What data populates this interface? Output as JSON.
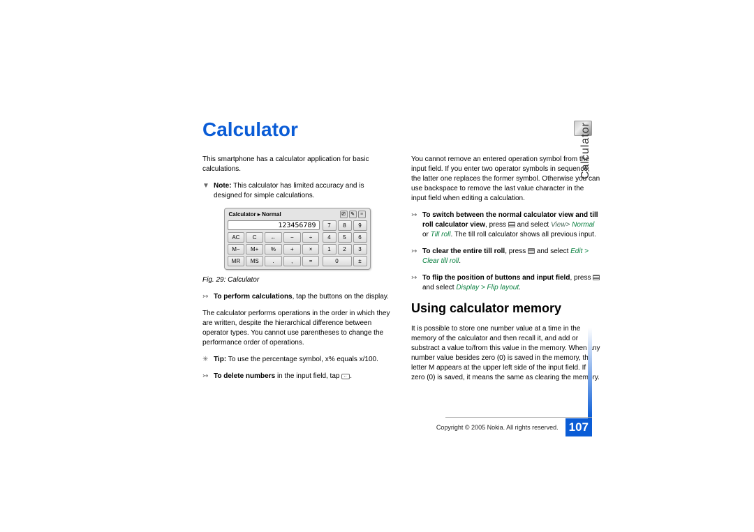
{
  "title": "Calculator",
  "side_tab": "Calculator",
  "left": {
    "intro": "This smartphone has a calculator application for basic calculations.",
    "note_label": "Note:",
    "note_text": "This calculator has limited accuracy and is designed for simple calculations.",
    "fig_caption": "Fig. 29: Calculator",
    "perform_bold": "To perform calculations",
    "perform_rest": ", tap the buttons on the display.",
    "order_para": "The calculator performs operations in the order in which they are written, despite the hierarchical difference between operator types. You cannot use parentheses to change the performance order of operations.",
    "tip_label": "Tip:",
    "tip_text": " To use the percentage symbol, x% equals x/100.",
    "delete_bold": "To delete numbers",
    "delete_rest": " in the input field, tap "
  },
  "right": {
    "intro": "You cannot remove an entered operation symbol from the input field. If you enter two operator symbols in sequence, the latter one replaces the former symbol. Otherwise you can use backspace to remove the last value character in the input field when editing a calculation.",
    "switch_bold": "To switch between the normal calculator view and till roll calculator view",
    "switch_mid": ", press ",
    "switch_select": " and select ",
    "switch_view": "View>",
    "switch_normal": "Normal",
    "switch_or": " or ",
    "switch_tillroll": "Till roll",
    "switch_tail": ". The till roll calculator shows all previous input.",
    "clear_bold": "To clear the entire till roll",
    "clear_mid": ", press ",
    "clear_select": " and select",
    "clear_menu": "Edit > Clear till roll",
    "clear_period": ".",
    "flip_bold": "To flip the position of buttons and input field",
    "flip_mid": ", press",
    "flip_select": " and select ",
    "flip_menu": "Display > Flip layout",
    "flip_period": ".",
    "subhead": "Using calculator memory",
    "memory_para": "It is possible to store one number value at a time in the memory of the calculator and then recall it, and add or substract a value to/from this value in the memory. When any number value besides zero (0) is saved in the memory, the letter M appears at the upper left side of the input field. If zero (0) is saved, it means the same as clearing the memory."
  },
  "calculator": {
    "title_app": "Calculator",
    "title_caret": "▸",
    "title_mode": "Normal",
    "display": "123456789",
    "left_buttons": [
      "AC",
      "C",
      "←",
      "−",
      "÷",
      "M−",
      "M+",
      "%",
      "+",
      "×",
      "MR",
      "MS",
      ".",
      ",",
      "="
    ],
    "right_buttons": [
      "7",
      "8",
      "9",
      "4",
      "5",
      "6",
      "1",
      "2",
      "3",
      "0",
      "±"
    ]
  },
  "footer": {
    "copyright": "Copyright © 2005 Nokia. All rights reserved.",
    "page": "107"
  }
}
